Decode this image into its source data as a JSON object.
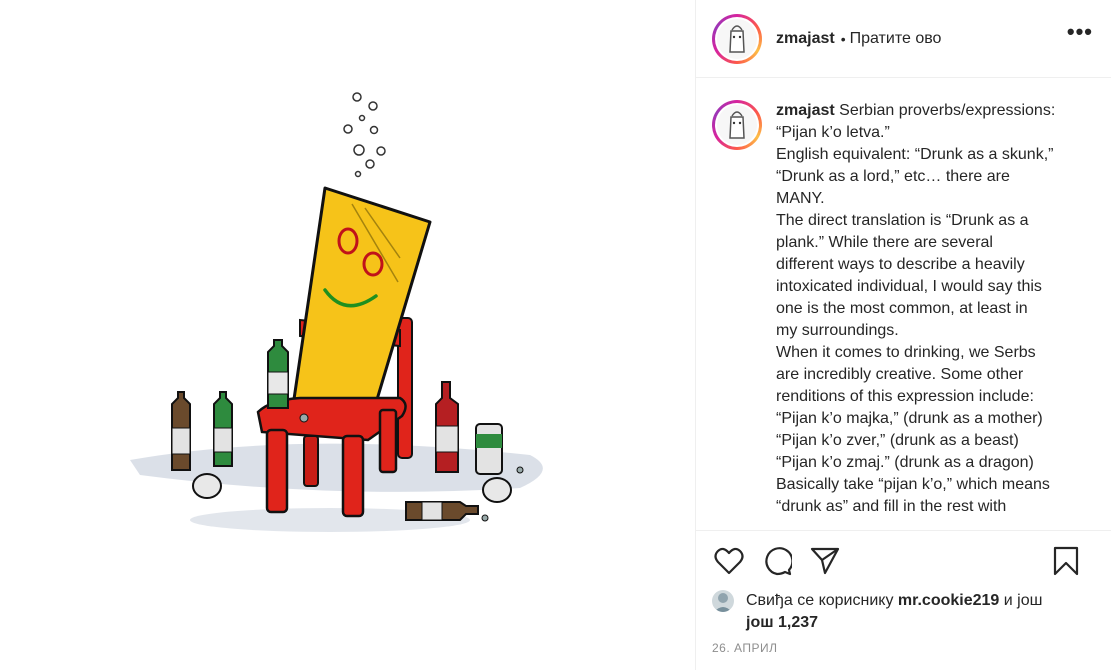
{
  "header": {
    "username": "zmajast",
    "separator": "•",
    "follow_label": "Пратите ово",
    "more_label": "•••"
  },
  "caption": {
    "username": "zmajast",
    "lines": [
      "Serbian proverbs/expressions:",
      "“Pijan k’o letva.”",
      "English equivalent: “Drunk as a skunk,”",
      "“Drunk as a lord,” etc… there are",
      "MANY.",
      "The direct translation is “Drunk as a",
      "plank.” While there are several",
      "different ways to describe a heavily",
      "intoxicated individual, I would say this",
      "one is the most common, at least in",
      "my surroundings.",
      "When it comes to drinking, we Serbs",
      "are incredibly creative. Some other",
      "renditions of this expression include:",
      "“Pijan k’o majka,” (drunk as a mother)",
      "“Pijan k’o zver,” (drunk as a beast)",
      "“Pijan k’o zmaj.” (drunk as a dragon)",
      "Basically take “pijan k’o,” which means",
      "“drunk as” and fill in the rest with"
    ]
  },
  "actions": {
    "like": "heart-icon",
    "comment": "comment-icon",
    "share": "paper-plane-icon",
    "save": "bookmark-icon"
  },
  "likes": {
    "prefix": "Свиђа се кориснику",
    "user": "mr.cookie219",
    "middle": "и још",
    "count_prefix": "још",
    "count": "1,237"
  },
  "timestamp": "26. АПРИЛ",
  "colors": {
    "text": "#262626",
    "muted": "#8e8e8e",
    "plank": "#f7c514",
    "chair": "#e0241b",
    "border": "#efefef"
  }
}
